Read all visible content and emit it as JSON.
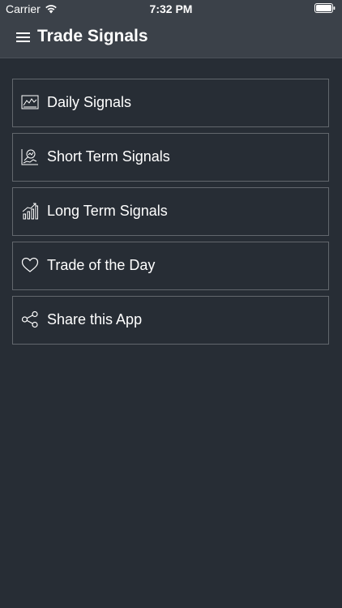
{
  "status_bar": {
    "carrier": "Carrier",
    "time": "7:32 PM"
  },
  "header": {
    "title": "Trade Signals"
  },
  "menu": {
    "items": [
      {
        "label": "Daily Signals",
        "icon": "chart-area-icon"
      },
      {
        "label": "Short Term Signals",
        "icon": "chart-search-icon"
      },
      {
        "label": "Long Term Signals",
        "icon": "bar-chart-trend-icon"
      },
      {
        "label": "Trade of the Day",
        "icon": "heart-icon"
      },
      {
        "label": "Share this App",
        "icon": "share-icon"
      }
    ]
  },
  "colors": {
    "background": "#272d35",
    "header": "#3b4149",
    "item_border": "#62676d",
    "text": "#ffffff"
  }
}
